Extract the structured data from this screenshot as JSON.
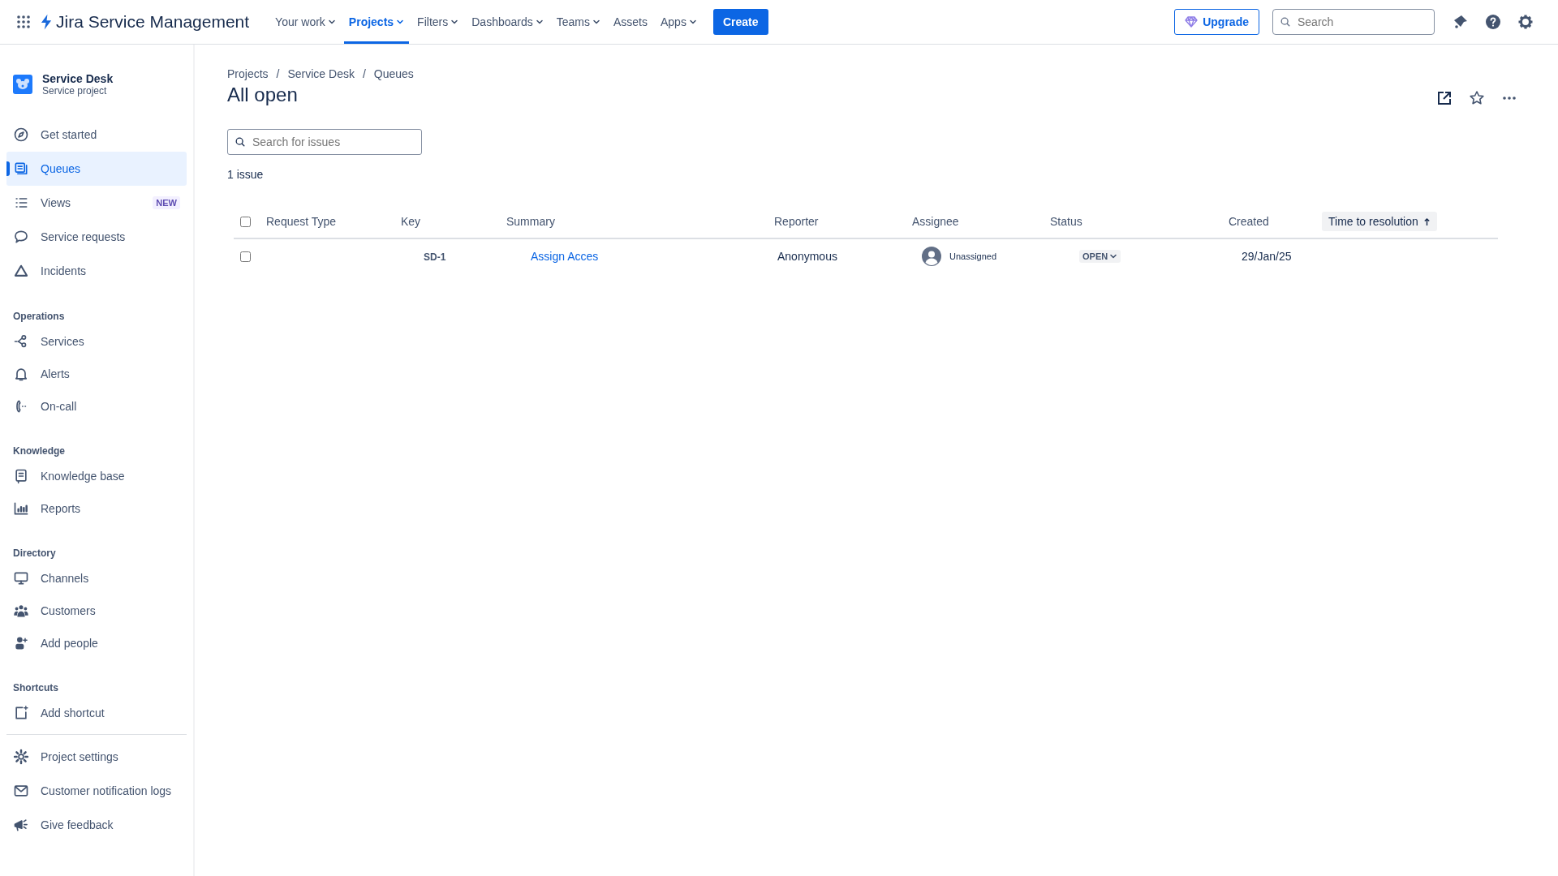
{
  "topbar": {
    "product": "Jira Service Management",
    "nav": [
      {
        "label": "Your work",
        "selected": false,
        "dropdown": true
      },
      {
        "label": "Projects",
        "selected": true,
        "dropdown": true
      },
      {
        "label": "Filters",
        "selected": false,
        "dropdown": true
      },
      {
        "label": "Dashboards",
        "selected": false,
        "dropdown": true
      },
      {
        "label": "Teams",
        "selected": false,
        "dropdown": true
      },
      {
        "label": "Assets",
        "selected": false,
        "dropdown": false
      },
      {
        "label": "Apps",
        "selected": false,
        "dropdown": true
      }
    ],
    "create": "Create",
    "upgrade": "Upgrade",
    "search": {
      "placeholder": "Search"
    }
  },
  "sidebar": {
    "project": {
      "name": "Service Desk",
      "type": "Service project"
    },
    "items": [
      {
        "label": "Get started",
        "selected": false
      },
      {
        "label": "Queues",
        "selected": true
      },
      {
        "label": "Views",
        "selected": false,
        "badge": "NEW"
      },
      {
        "label": "Service requests",
        "selected": false
      },
      {
        "label": "Incidents",
        "selected": false
      }
    ],
    "sections": [
      {
        "heading": "Operations",
        "items": [
          {
            "label": "Services",
            "selected": false
          },
          {
            "label": "Alerts",
            "selected": false
          },
          {
            "label": "On-call",
            "selected": false
          }
        ]
      },
      {
        "heading": "Knowledge",
        "items": [
          {
            "label": "Knowledge base",
            "selected": false
          },
          {
            "label": "Reports",
            "selected": false
          }
        ]
      },
      {
        "heading": "Directory",
        "items": [
          {
            "label": "Channels",
            "selected": false
          },
          {
            "label": "Customers",
            "selected": false
          },
          {
            "label": "Add people",
            "selected": false
          }
        ]
      },
      {
        "heading": "Shortcuts",
        "items": [
          {
            "label": "Add shortcut",
            "selected": false
          }
        ]
      }
    ],
    "footer_items": [
      {
        "label": "Project settings",
        "selected": false
      },
      {
        "label": "Customer notification logs",
        "selected": false
      },
      {
        "label": "Give feedback",
        "selected": false
      }
    ]
  },
  "breadcrumbs": {
    "separator": "/",
    "items": [
      "Projects",
      "Service Desk",
      "Queues"
    ]
  },
  "title": "All open",
  "issue_search": {
    "placeholder": "Search for issues"
  },
  "count": "1 issue",
  "table": {
    "columns": [
      {
        "label": "Request Type",
        "sorted": false
      },
      {
        "label": "Key",
        "sorted": false
      },
      {
        "label": "Summary",
        "sorted": false
      },
      {
        "label": "Reporter",
        "sorted": false
      },
      {
        "label": "Assignee",
        "sorted": false
      },
      {
        "label": "Status",
        "sorted": false
      },
      {
        "label": "Created",
        "sorted": false
      },
      {
        "label": "Time to resolution",
        "sorted": true
      }
    ],
    "all_checked": false,
    "rows": [
      {
        "checked": false,
        "key": "SD-1",
        "summary": "Assign Acces",
        "reporter": "Anonymous",
        "assignee": "Unassigned",
        "status": "OPEN",
        "created": "29/Jan/25"
      }
    ]
  }
}
